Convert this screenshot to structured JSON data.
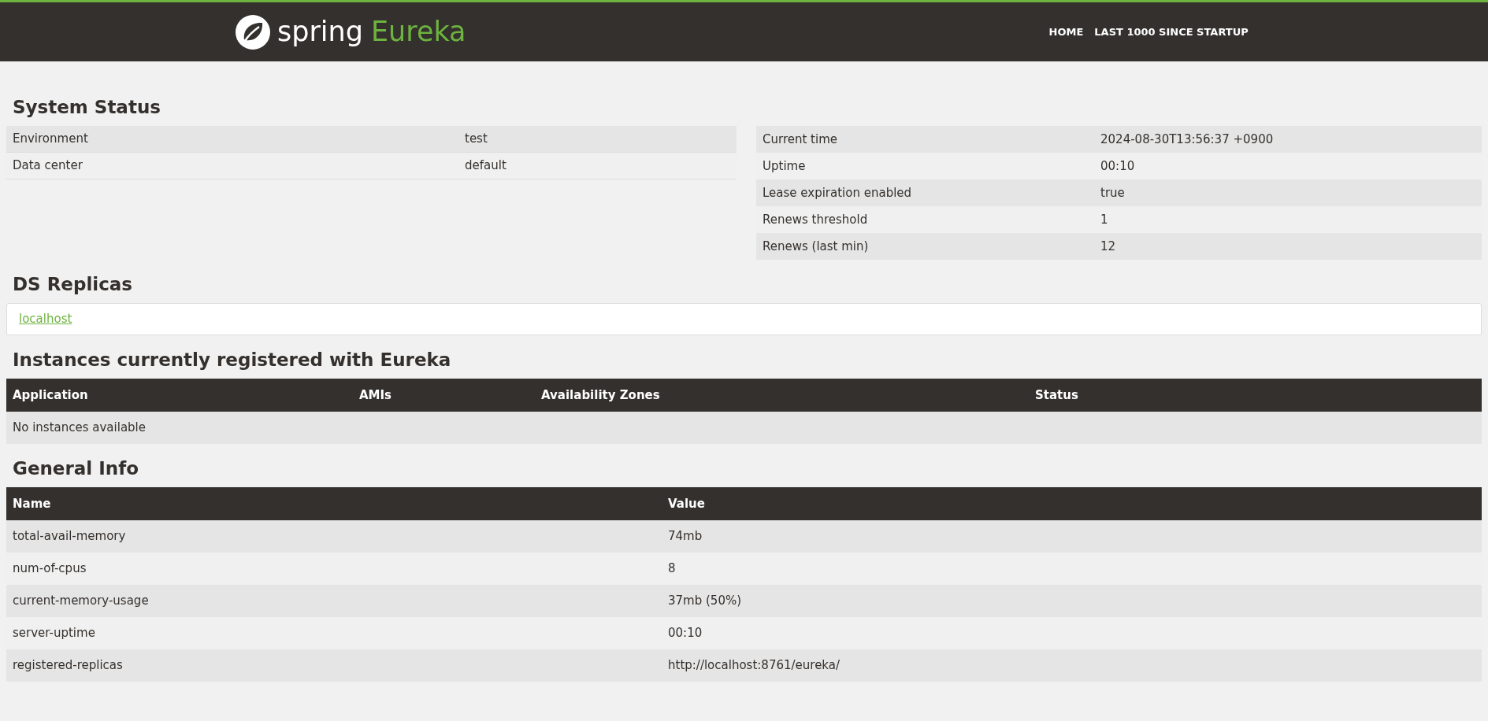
{
  "header": {
    "logo_word": "spring",
    "logo_product": "Eureka",
    "nav": [
      {
        "label": "HOME"
      },
      {
        "label": "LAST 1000 SINCE STARTUP"
      }
    ]
  },
  "system_status": {
    "title": "System Status",
    "left": [
      {
        "name": "Environment",
        "value": "test"
      },
      {
        "name": "Data center",
        "value": "default"
      }
    ],
    "right": [
      {
        "name": "Current time",
        "value": "2024-08-30T13:56:37 +0900"
      },
      {
        "name": "Uptime",
        "value": "00:10"
      },
      {
        "name": "Lease expiration enabled",
        "value": "true"
      },
      {
        "name": "Renews threshold",
        "value": "1"
      },
      {
        "name": "Renews (last min)",
        "value": "12"
      }
    ]
  },
  "ds_replicas": {
    "title": "DS Replicas",
    "links": [
      "localhost"
    ]
  },
  "instances": {
    "title": "Instances currently registered with Eureka",
    "columns": [
      "Application",
      "AMIs",
      "Availability Zones",
      "Status"
    ],
    "empty_message": "No instances available"
  },
  "general_info": {
    "title": "General Info",
    "columns": [
      "Name",
      "Value"
    ],
    "rows": [
      {
        "name": "total-avail-memory",
        "value": "74mb"
      },
      {
        "name": "num-of-cpus",
        "value": "8"
      },
      {
        "name": "current-memory-usage",
        "value": "37mb (50%)"
      },
      {
        "name": "server-uptime",
        "value": "00:10"
      },
      {
        "name": "registered-replicas",
        "value": "http://localhost:8761/eureka/"
      }
    ]
  }
}
